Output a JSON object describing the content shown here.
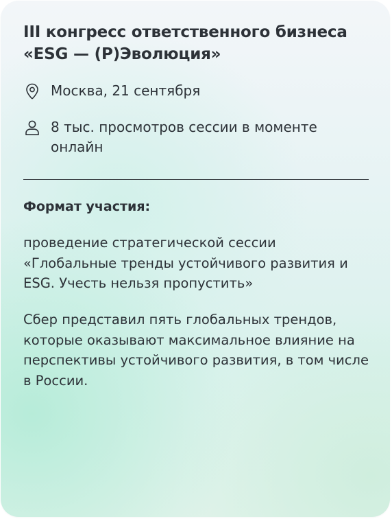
{
  "card": {
    "title": "III конгресс ответственного бизнеса «ESG — (Р)Эволюция»",
    "location": {
      "icon": "location-pin-icon",
      "text": "Москва, 21 сентября"
    },
    "views": {
      "icon": "person-icon",
      "text": "8 тыс. просмотров сессии в моменте онлайн"
    },
    "format_label": "Формат участия:",
    "format_description": "проведение стратегической сессии «Глобальные тренды устойчивого развития и ESG. Учесть нельзя пропустить»",
    "summary": "Сбер представил пять глобальных трендов, которые оказывают максимальное влия­ние на перспективы устойчивого развития, в том числе в России."
  },
  "colors": {
    "text": "#2d3238",
    "divider": "#3a3f44",
    "gradient_mint": "#b7ecd9"
  }
}
